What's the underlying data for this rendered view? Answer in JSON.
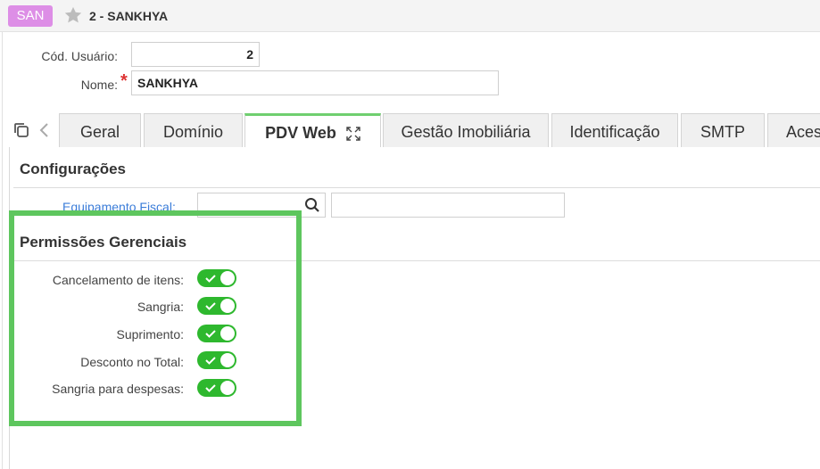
{
  "header": {
    "badge": "SAN",
    "title": "2 - SANKHYA"
  },
  "form": {
    "user_code_label": "Cód. Usuário:",
    "user_code_value": "2",
    "name_label": "Nome:",
    "name_value": "SANKHYA"
  },
  "tabs": [
    {
      "label": "Geral"
    },
    {
      "label": "Domínio"
    },
    {
      "label": "PDV Web"
    },
    {
      "label": "Gestão Imobiliária"
    },
    {
      "label": "Identificação"
    },
    {
      "label": "SMTP"
    },
    {
      "label": "Aces"
    }
  ],
  "active_tab": "PDV Web",
  "config": {
    "title": "Configurações",
    "fiscal_label": "Equipamento Fiscal:"
  },
  "permissions": {
    "title": "Permissões Gerenciais",
    "items": [
      {
        "label": "Cancelamento de itens:",
        "on": true
      },
      {
        "label": "Sangria:",
        "on": true
      },
      {
        "label": "Suprimento:",
        "on": true
      },
      {
        "label": "Desconto no Total:",
        "on": true
      },
      {
        "label": "Sangria para despesas:",
        "on": true
      }
    ]
  },
  "colors": {
    "badge": "#dd8ee6",
    "toggle_on": "#2eb82e",
    "highlight": "#5ec65e",
    "active_tab_accent": "#6fcf6f",
    "link": "#3b7dd8",
    "required": "#dd3333"
  },
  "icons": [
    "star-icon",
    "copy-icon",
    "chevron-left-icon",
    "expand-icon",
    "search-icon",
    "check-icon"
  ]
}
